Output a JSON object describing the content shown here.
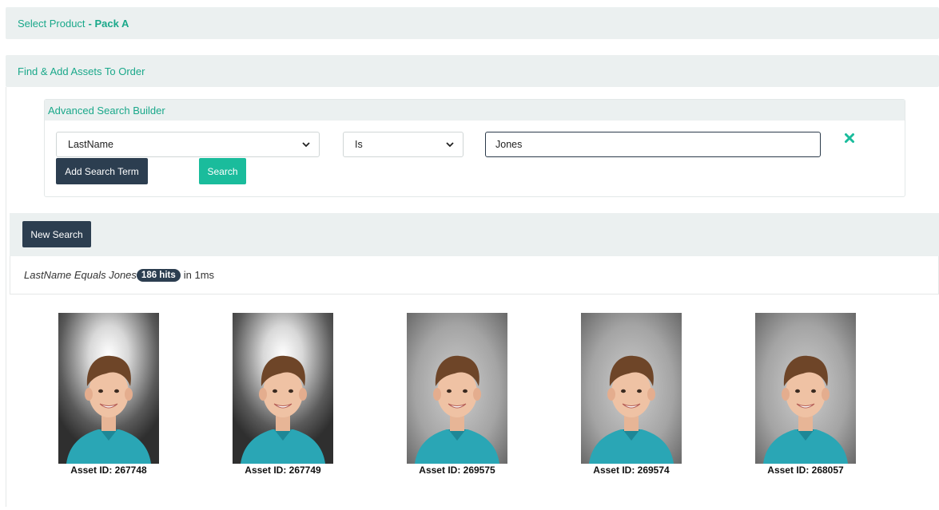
{
  "select_product": {
    "label": "Select Product",
    "value": "- Pack A"
  },
  "find_panel": {
    "title": "Find & Add Assets To Order"
  },
  "builder": {
    "title": "Advanced Search Builder",
    "field_select": "LastName",
    "operator_select": "Is",
    "term_value": "Jones",
    "add_term_label": "Add Search Term",
    "search_label": "Search"
  },
  "results": {
    "new_search_label": "New Search",
    "query_text": "LastName Equals Jones",
    "hits": "186 hits",
    "timing": "in 1ms"
  },
  "assets": [
    {
      "caption": "Asset ID: 267748",
      "style": "spot"
    },
    {
      "caption": "Asset ID: 267749",
      "style": "spot"
    },
    {
      "caption": "Asset ID: 269575",
      "style": "grey"
    },
    {
      "caption": "Asset ID: 269574",
      "style": "grey"
    },
    {
      "caption": "Asset ID: 268057",
      "style": "grey"
    }
  ],
  "colors": {
    "accent": "#1abc9c",
    "dark": "#2c3e50",
    "panel": "#ebf0f0"
  }
}
